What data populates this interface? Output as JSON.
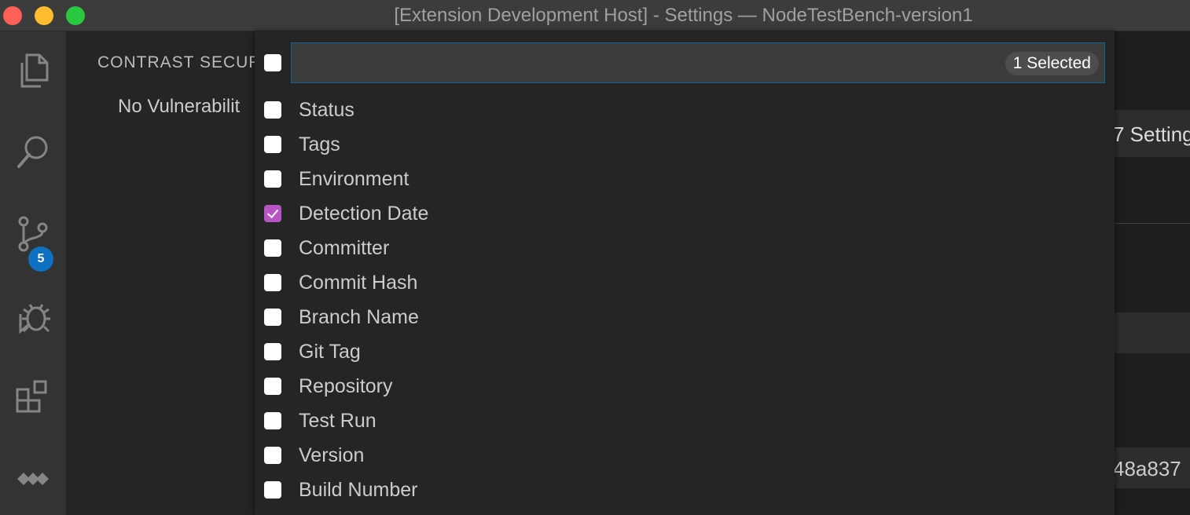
{
  "window": {
    "title": "[Extension Development Host] - Settings — NodeTestBench-version1"
  },
  "activity_bar": {
    "items": [
      {
        "icon": "files-icon"
      },
      {
        "icon": "search-icon"
      },
      {
        "icon": "source-control-icon",
        "badge": "5"
      },
      {
        "icon": "debug-icon"
      },
      {
        "icon": "extensions-icon"
      },
      {
        "icon": "contrast-logo-icon"
      }
    ]
  },
  "sidebar": {
    "title": "CONTRAST SECUR",
    "empty_message": "No Vulnerabilit"
  },
  "background": {
    "settings_fragment": "7 Setting",
    "hash_fragment": "48a837"
  },
  "quick_pick": {
    "input_value": "",
    "selected_count": "1 Selected",
    "items": [
      {
        "label": "Status",
        "checked": false
      },
      {
        "label": "Tags",
        "checked": false
      },
      {
        "label": "Environment",
        "checked": false
      },
      {
        "label": "Detection Date",
        "checked": true
      },
      {
        "label": "Committer",
        "checked": false
      },
      {
        "label": "Commit Hash",
        "checked": false
      },
      {
        "label": "Branch Name",
        "checked": false
      },
      {
        "label": "Git Tag",
        "checked": false
      },
      {
        "label": "Repository",
        "checked": false
      },
      {
        "label": "Test Run",
        "checked": false
      },
      {
        "label": "Version",
        "checked": false
      },
      {
        "label": "Build Number",
        "checked": false
      }
    ]
  },
  "colors": {
    "accent_check": "#b854c4",
    "badge": "#0e70c0",
    "input_border": "#0e639c"
  }
}
